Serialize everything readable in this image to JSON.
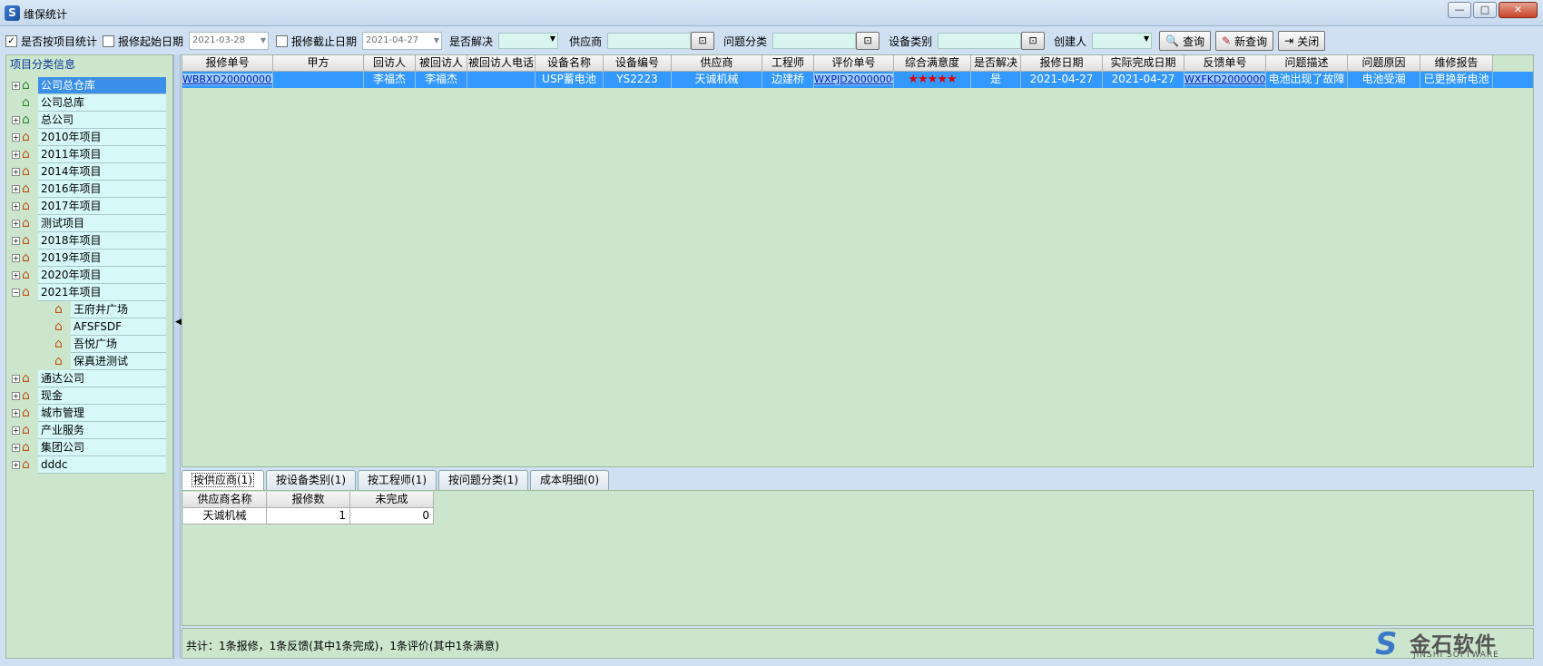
{
  "window": {
    "title": "维保统计",
    "buttons": {
      "minimize": "—",
      "maximize": "□",
      "close": "✕"
    }
  },
  "toolbar": {
    "by_project_label": "是否按项目统计",
    "by_project_checked": true,
    "start_date_label": "报修起始日期",
    "start_date_checked": false,
    "start_date_value": "2021-03-28",
    "end_date_label": "报修截止日期",
    "end_date_checked": false,
    "end_date_value": "2021-04-27",
    "resolved_label": "是否解决",
    "resolved_value": "",
    "supplier_label": "供应商",
    "supplier_value": "",
    "category_label": "问题分类",
    "category_value": "",
    "device_type_label": "设备类别",
    "device_type_value": "",
    "creator_label": "创建人",
    "creator_value": "",
    "query_button": "查询",
    "new_query_button": "新查询",
    "close_button": "关闭"
  },
  "sidebar": {
    "title": "项目分类信息",
    "items": [
      {
        "label": "公司总仓库",
        "expander": "+",
        "level": 0,
        "selected": true
      },
      {
        "label": "公司总库",
        "expander": "",
        "level": 0,
        "selected": false
      },
      {
        "label": "总公司",
        "expander": "+",
        "level": 0,
        "selected": false
      },
      {
        "label": "2010年项目",
        "expander": "+",
        "level": 0,
        "selected": false
      },
      {
        "label": "2011年项目",
        "expander": "+",
        "level": 0,
        "selected": false
      },
      {
        "label": "2014年项目",
        "expander": "+",
        "level": 0,
        "selected": false
      },
      {
        "label": "2016年项目",
        "expander": "+",
        "level": 0,
        "selected": false
      },
      {
        "label": "2017年项目",
        "expander": "+",
        "level": 0,
        "selected": false
      },
      {
        "label": "测试项目",
        "expander": "+",
        "level": 0,
        "selected": false
      },
      {
        "label": "2018年项目",
        "expander": "+",
        "level": 0,
        "selected": false
      },
      {
        "label": "2019年项目",
        "expander": "+",
        "level": 0,
        "selected": false
      },
      {
        "label": "2020年项目",
        "expander": "+",
        "level": 0,
        "selected": false
      },
      {
        "label": "2021年项目",
        "expander": "−",
        "level": 0,
        "selected": false
      },
      {
        "label": "王府井广场",
        "expander": "",
        "level": 1,
        "selected": false
      },
      {
        "label": "AFSFSDF",
        "expander": "",
        "level": 1,
        "selected": false
      },
      {
        "label": "吾悦广场",
        "expander": "",
        "level": 1,
        "selected": false
      },
      {
        "label": "保真进测试",
        "expander": "",
        "level": 1,
        "selected": false
      },
      {
        "label": "通达公司",
        "expander": "+",
        "level": 0,
        "selected": false
      },
      {
        "label": "现金",
        "expander": "+",
        "level": 0,
        "selected": false
      },
      {
        "label": "城市管理",
        "expander": "+",
        "level": 0,
        "selected": false
      },
      {
        "label": "产业服务",
        "expander": "+",
        "level": 0,
        "selected": false
      },
      {
        "label": "集团公司",
        "expander": "+",
        "level": 0,
        "selected": false
      },
      {
        "label": "dddc",
        "expander": "+",
        "level": 0,
        "selected": false
      }
    ]
  },
  "main_table": {
    "columns": [
      "报修单号",
      "甲方",
      "回访人",
      "被回访人",
      "被回访人电话",
      "设备名称",
      "设备编号",
      "供应商",
      "工程师",
      "评价单号",
      "综合满意度",
      "是否解决",
      "报修日期",
      "实际完成日期",
      "反馈单号",
      "问题描述",
      "问题原因",
      "维修报告"
    ],
    "rows": [
      [
        "WBBXD200000001",
        "",
        "李福杰",
        "李福杰",
        "",
        "USP蓄电池",
        "YS2223",
        "天诚机械",
        "边建桥",
        "WXPJD200000001",
        "★★★★★",
        "是",
        "2021-04-27",
        "2021-04-27",
        "WXFKD200000001",
        "电池出现了故障",
        "电池受潮",
        "已更换新电池"
      ]
    ]
  },
  "tabs": [
    "按供应商(1)",
    "按设备类别(1)",
    "按工程师(1)",
    "按问题分类(1)",
    "成本明细(0)"
  ],
  "sub_table": {
    "columns": [
      "供应商名称",
      "报修数",
      "未完成"
    ],
    "rows": [
      [
        "天诚机械",
        "1",
        "0"
      ]
    ]
  },
  "footer": {
    "summary": "共计：1条报修，1条反馈(其中1条完成)，1条评价(其中1条满意)"
  },
  "logo": {
    "cn": "金石软件",
    "en": "JINSHI SOFTWARE"
  },
  "colors": {
    "selection": "#3399ff",
    "grid_bg": "#cce6cd",
    "tree_item_bg": "#d6f8f8",
    "field_bg": "#d8f5f0",
    "stars": "#e00000"
  }
}
